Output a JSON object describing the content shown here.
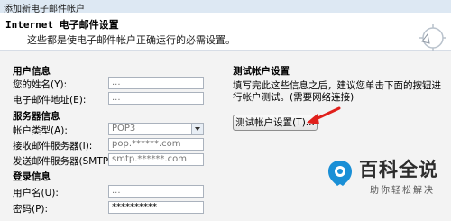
{
  "window": {
    "title": "添加新电子邮件帐户"
  },
  "header": {
    "title": "Internet 电子邮件设置",
    "subtitle": "这些都是使电子邮件帐户正确运行的必需设置。",
    "icon": "mail-wizard-icon"
  },
  "user_info": {
    "section_label": "用户信息",
    "name_label": "您的姓名(Y):",
    "name_value": "...",
    "email_label": "电子邮件地址(E):",
    "email_value": "..."
  },
  "server_info": {
    "section_label": "服务器信息",
    "account_type_label": "帐户类型(A):",
    "account_type_value": "POP3",
    "incoming_label": "接收邮件服务器(I):",
    "incoming_value": "pop.******.com",
    "outgoing_label": "发送邮件服务器(SMTP)(O):",
    "outgoing_value": "smtp.******.com"
  },
  "login_info": {
    "section_label": "登录信息",
    "username_label": "用户名(U):",
    "username_value": "...",
    "password_label": "密码(P):",
    "password_value": "**********"
  },
  "test_panel": {
    "title": "测试帐户设置",
    "desc_line1": "填写完此这些信息之后，建议您单击下面的按钮进",
    "desc_line2": "行帐户测试。(需要网络连接)",
    "test_button_label": "测试帐户设置(T)..."
  },
  "watermark": {
    "title": "百科全说",
    "subtitle": "助你轻松解决",
    "icon": "baike-logo-icon"
  },
  "colors": {
    "annotation_arrow": "#e0201b",
    "logo_blue": "#1a8fd6"
  }
}
